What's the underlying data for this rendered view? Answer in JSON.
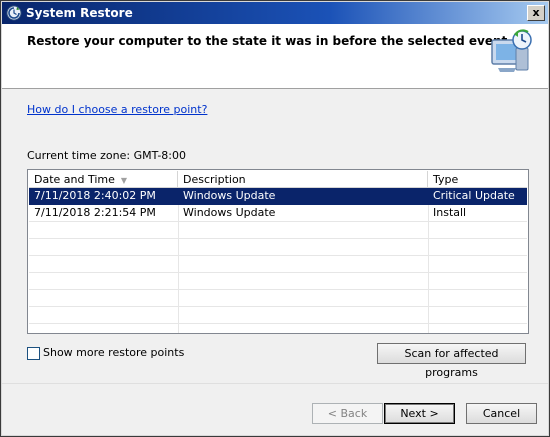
{
  "window": {
    "title": "System Restore",
    "close_glyph": "x"
  },
  "header": {
    "text": "Restore your computer to the state it was in before the selected event",
    "icon": "system-restore-icon"
  },
  "help_link": "How do I choose a restore point?",
  "timezone_label": "Current time zone: GMT-8:00",
  "table": {
    "columns": [
      "Date and Time",
      "Description",
      "Type"
    ],
    "sort_indicator": "▼",
    "rows": [
      {
        "date": "7/11/2018 2:40:02 PM",
        "description": "Windows Update",
        "type": "Critical Update",
        "selected": true
      },
      {
        "date": "7/11/2018 2:21:54 PM",
        "description": "Windows Update",
        "type": "Install",
        "selected": false
      }
    ]
  },
  "show_more_label": "Show more restore points",
  "show_more_checked": false,
  "scan_button": "Scan for affected programs",
  "buttons": {
    "back": "< Back",
    "next": "Next >",
    "cancel": "Cancel"
  },
  "colors": {
    "title_bar": "#0a246a",
    "selection": "#0a246a",
    "link": "#0033cc"
  }
}
